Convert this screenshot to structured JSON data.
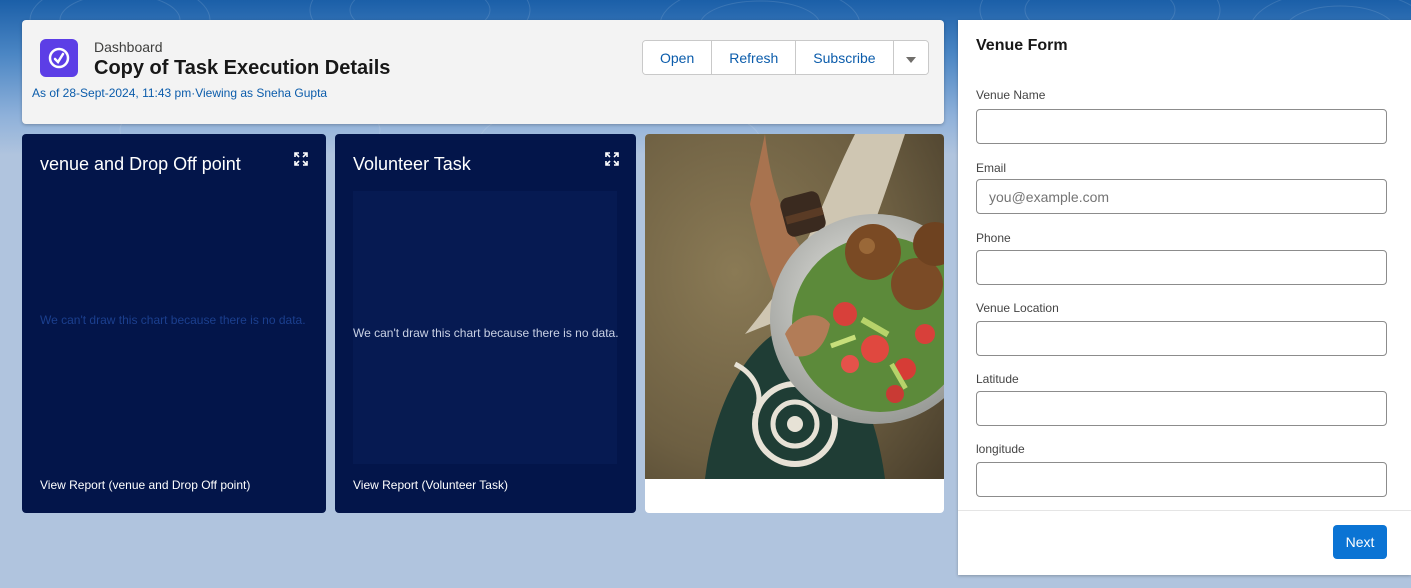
{
  "header": {
    "eyebrow": "Dashboard",
    "title": "Copy of Task Execution Details",
    "subtitle": "As of 28-Sept-2024, 11:43 pm·Viewing as Sneha Gupta",
    "buttons": {
      "open": "Open",
      "refresh": "Refresh",
      "subscribe": "Subscribe",
      "more_icon": "chevron-down-icon"
    }
  },
  "widgets": [
    {
      "title": "venue and Drop Off point",
      "empty_message": "We can't draw this chart because there is no data.",
      "view_report": "View Report (venue and Drop Off point)"
    },
    {
      "title": "Volunteer Task",
      "empty_message": "We can't draw this chart because there is no data.",
      "view_report": "View Report (Volunteer Task)"
    }
  ],
  "form": {
    "title": "Venue Form",
    "fields": [
      {
        "label": "Venue Name",
        "value": "",
        "placeholder": ""
      },
      {
        "label": "Email",
        "value": "",
        "placeholder": "you@example.com"
      },
      {
        "label": "Phone",
        "value": "",
        "placeholder": ""
      },
      {
        "label": "Venue Location",
        "value": "",
        "placeholder": ""
      },
      {
        "label": "Latitude",
        "value": "",
        "placeholder": ""
      },
      {
        "label": "longitude",
        "value": "",
        "placeholder": ""
      }
    ],
    "next_label": "Next"
  },
  "colors": {
    "page_bg": "#b0c4de",
    "widget_bg": "#03154a",
    "brand_blue": "#0b5cab",
    "button_blue": "#0b74d4",
    "dashboard_icon_bg": "#5c3ee6"
  }
}
